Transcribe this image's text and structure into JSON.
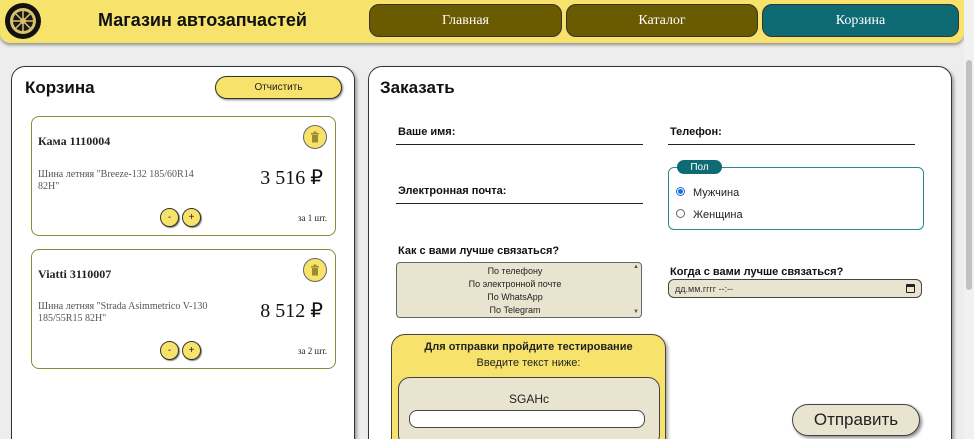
{
  "header": {
    "site_title": "Магазин автозапчастей",
    "nav": {
      "home": "Главная",
      "catalog": "Каталог",
      "cart": "Корзина"
    }
  },
  "cart": {
    "title": "Корзина",
    "clear_label": "Отчистить",
    "items": [
      {
        "name": "Кама 1110004",
        "description": "Шина летняя \"Breeze-132 185/60R14 82H\"",
        "price": "3 516 ₽",
        "qty": "за 1 шт.",
        "minus": "-",
        "plus": "+"
      },
      {
        "name": "Viatti 3110007",
        "description": "Шина летняя \"Strada Asimmetrico V-130 185/55R15 82H\"",
        "price": "8 512 ₽",
        "qty": "за 2 шт.",
        "minus": "-",
        "plus": "+"
      }
    ]
  },
  "order": {
    "title": "Заказать",
    "name_label": "Ваше имя:",
    "phone_label": "Телефон:",
    "email_label": "Электронная почта:",
    "gender": {
      "legend": "Пол",
      "options": [
        "Мужчина",
        "Женщина"
      ],
      "selected": "Мужчина"
    },
    "contact_method_label": "Как с вами лучше связаться?",
    "contact_methods": [
      "По телефону",
      "По электронной почте",
      "По WhatsApp",
      "По Telegram"
    ],
    "contact_time_label": "Когда с вами лучше связаться?",
    "date_placeholder": "дд.мм.гггг --:--",
    "captcha": {
      "title": "Для отправки пройдите тестирование",
      "subtitle": "Введите текст ниже:",
      "code": "SGAHc"
    },
    "submit_label": "Отправить"
  },
  "colors": {
    "accent_yellow": "#f7e36b",
    "nav_olive": "#6a5a00",
    "nav_teal": "#0e6b74",
    "radio_blue": "#1a6fd6"
  },
  "icons": {
    "logo": "wheel-logo-icon",
    "trash": "trash-icon",
    "calendar": "calendar-icon"
  }
}
